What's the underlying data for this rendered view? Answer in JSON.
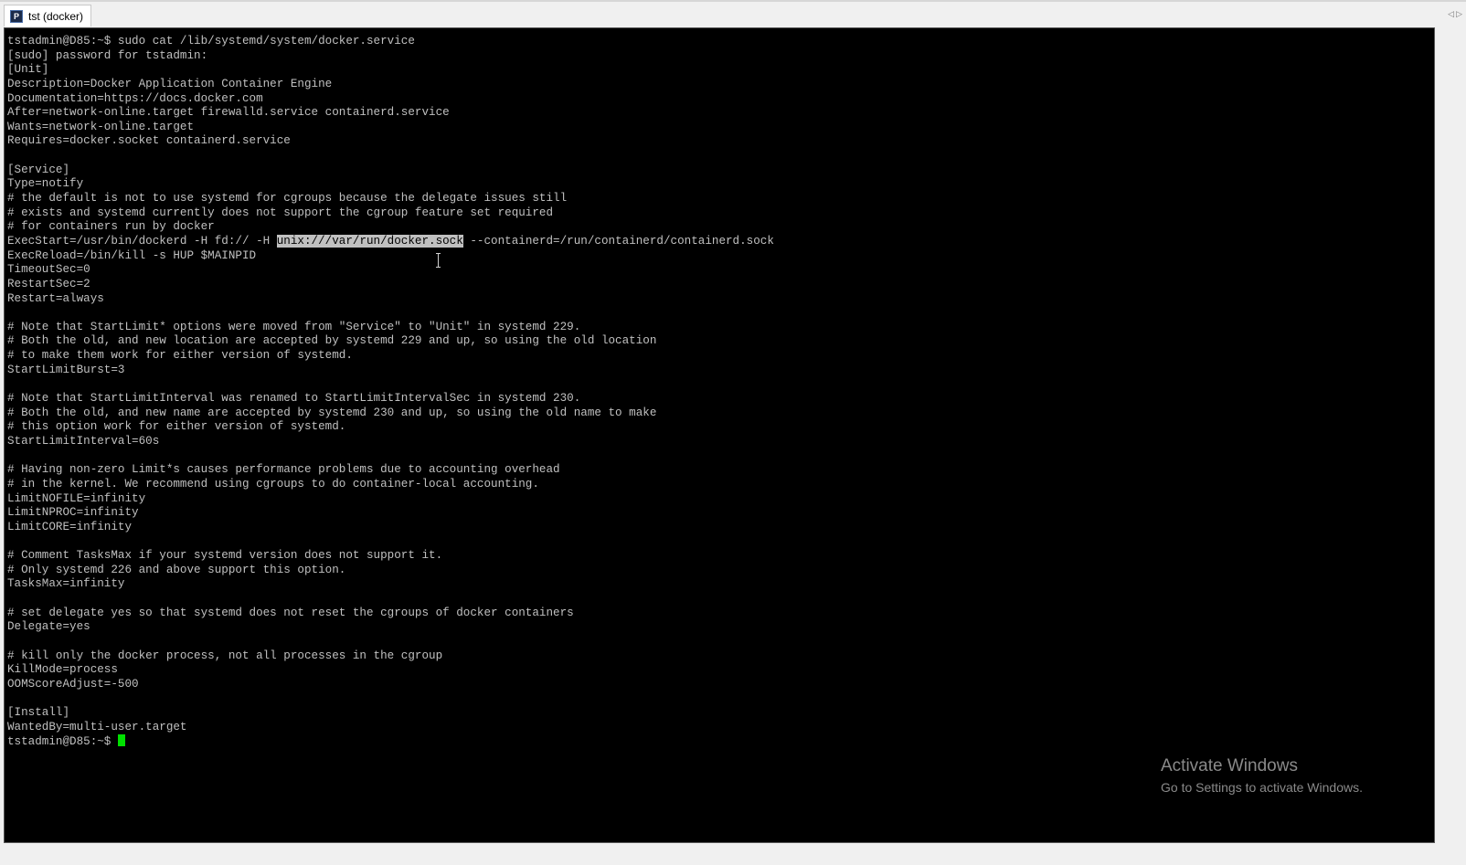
{
  "tab": {
    "title": "tst (docker)",
    "icon": "putty-terminal-icon"
  },
  "terminal": {
    "lines": [
      "tstadmin@D85:~$ sudo cat /lib/systemd/system/docker.service",
      "[sudo] password for tstadmin:",
      "[Unit]",
      "Description=Docker Application Container Engine",
      "Documentation=https://docs.docker.com",
      "After=network-online.target firewalld.service containerd.service",
      "Wants=network-online.target",
      "Requires=docker.socket containerd.service",
      "",
      "[Service]",
      "Type=notify",
      "# the default is not to use systemd for cgroups because the delegate issues still",
      "# exists and systemd currently does not support the cgroup feature set required",
      "# for containers run by docker",
      "ExecStart=/usr/bin/dockerd -H fd:// -H unix:///var/run/docker.sock --containerd=/run/containerd/containerd.sock",
      "ExecReload=/bin/kill -s HUP $MAINPID",
      "TimeoutSec=0",
      "RestartSec=2",
      "Restart=always",
      "",
      "# Note that StartLimit* options were moved from \"Service\" to \"Unit\" in systemd 229.",
      "# Both the old, and new location are accepted by systemd 229 and up, so using the old location",
      "# to make them work for either version of systemd.",
      "StartLimitBurst=3",
      "",
      "# Note that StartLimitInterval was renamed to StartLimitIntervalSec in systemd 230.",
      "# Both the old, and new name are accepted by systemd 230 and up, so using the old name to make",
      "# this option work for either version of systemd.",
      "StartLimitInterval=60s",
      "",
      "# Having non-zero Limit*s causes performance problems due to accounting overhead",
      "# in the kernel. We recommend using cgroups to do container-local accounting.",
      "LimitNOFILE=infinity",
      "LimitNPROC=infinity",
      "LimitCORE=infinity",
      "",
      "# Comment TasksMax if your systemd version does not support it.",
      "# Only systemd 226 and above support this option.",
      "TasksMax=infinity",
      "",
      "# set delegate yes so that systemd does not reset the cgroups of docker containers",
      "Delegate=yes",
      "",
      "# kill only the docker process, not all processes in the cgroup",
      "KillMode=process",
      "OOMScoreAdjust=-500",
      "",
      "[Install]",
      "WantedBy=multi-user.target"
    ],
    "selected_line_index": 14,
    "selected_text": "unix:///var/run/docker.sock",
    "prompt": "tstadmin@D85:~$ ",
    "colors": {
      "background": "#000000",
      "foreground": "#c0c0c0",
      "cursor": "#00e000",
      "selection_bg": "#c0c0c0"
    }
  },
  "watermark": {
    "title": "Activate Windows",
    "subtitle": "Go to Settings to activate Windows."
  }
}
